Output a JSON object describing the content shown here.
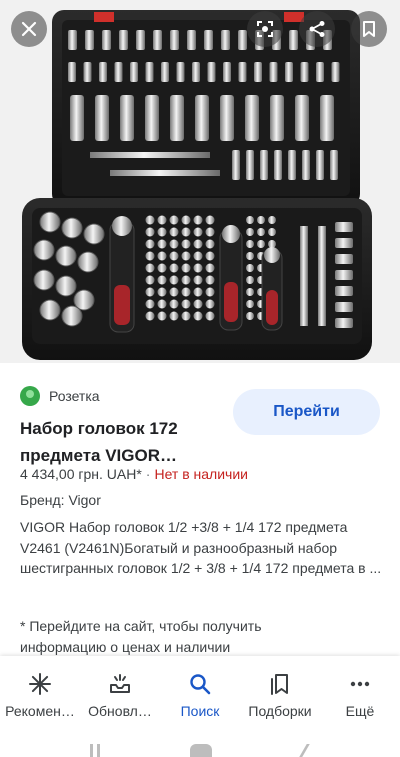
{
  "image": {
    "alt_icon": "socket-set-photo",
    "buttons": {
      "close": "close-icon",
      "lens": "lens-icon",
      "share": "share-icon",
      "save": "bookmark-icon"
    }
  },
  "result": {
    "source": "Розетка",
    "visit_button": "Перейти",
    "title": "Набор головок 172 предмета VIGOR…",
    "price": "4 434,00 грн. UAH*",
    "separator": "·",
    "stock": "Нет в наличии",
    "brand": "Бренд: Vigor",
    "description": "VIGOR Набор головок 1/2 +3/8 + 1/4 172 предмета V2461 (V2461N)Богатый и разнообразный набор шестигранных головок 1/2 + 3/8 + 1/4 172 предмета в ...",
    "note": "* Перейдите на сайт, чтобы получить информацию о ценах и наличии"
  },
  "nav": {
    "items": [
      {
        "label": "Рекомен…",
        "icon": "asterisk-icon"
      },
      {
        "label": "Обновл…",
        "icon": "updates-icon"
      },
      {
        "label": "Поиск",
        "icon": "search-icon"
      },
      {
        "label": "Подборки",
        "icon": "collections-icon"
      },
      {
        "label": "Ещё",
        "icon": "more-icon"
      }
    ]
  },
  "colors": {
    "accent": "#1a57c7",
    "visit_bg": "#e8f0fe",
    "out_of_stock": "#c5221f",
    "source_logo": "#36a84a"
  }
}
